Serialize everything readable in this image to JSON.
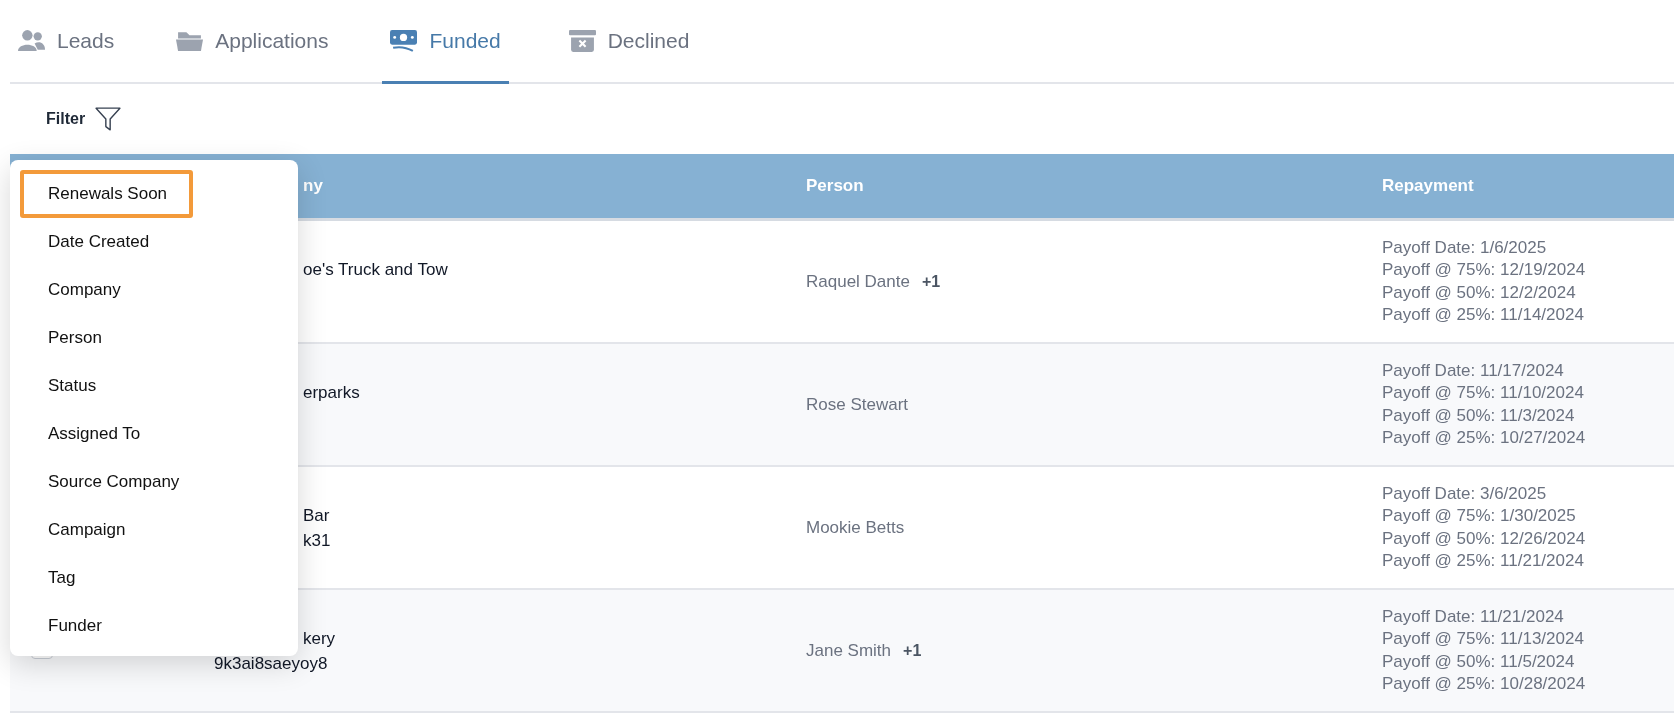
{
  "tabs": [
    {
      "label": "Leads",
      "selected": false
    },
    {
      "label": "Applications",
      "selected": false
    },
    {
      "label": "Funded",
      "selected": true
    },
    {
      "label": "Declined",
      "selected": false
    }
  ],
  "filter": {
    "label": "Filter"
  },
  "filter_menu": {
    "items": [
      {
        "label": "Renewals Soon",
        "selected": true
      },
      {
        "label": "Date Created",
        "selected": false
      },
      {
        "label": "Company",
        "selected": false
      },
      {
        "label": "Person",
        "selected": false
      },
      {
        "label": "Status",
        "selected": false
      },
      {
        "label": "Assigned To",
        "selected": false
      },
      {
        "label": "Source Company",
        "selected": false
      },
      {
        "label": "Campaign",
        "selected": false
      },
      {
        "label": "Tag",
        "selected": false
      },
      {
        "label": "Funder",
        "selected": false
      }
    ]
  },
  "table": {
    "columns": [
      "ny",
      "Person",
      "Repayment"
    ],
    "rows": [
      {
        "company": [
          "oe's Truck and Tow"
        ],
        "person": "Raquel Dante",
        "extra": "+1",
        "repayment": [
          "Payoff Date: 1/6/2025",
          "Payoff @ 75%: 12/19/2024",
          "Payoff @ 50%: 12/2/2024",
          "Payoff @ 25%: 11/14/2024"
        ]
      },
      {
        "company": [
          "erparks"
        ],
        "person": "Rose Stewart",
        "repayment": [
          "Payoff Date: 11/17/2024",
          "Payoff @ 75%: 11/10/2024",
          "Payoff @ 50%: 11/3/2024",
          "Payoff @ 25%: 10/27/2024"
        ]
      },
      {
        "company": [
          "Bar",
          "k31"
        ],
        "person": "Mookie Betts",
        "repayment": [
          "Payoff Date: 3/6/2025",
          "Payoff @ 75%: 1/30/2025",
          "Payoff @ 50%: 12/26/2024",
          "Payoff @ 25%: 11/21/2024"
        ]
      },
      {
        "checked": false,
        "company": [
          "kery",
          "9k3ai8saeyoy8"
        ],
        "person": "Jane Smith",
        "extra": "+1",
        "repayment": [
          "Payoff Date: 11/21/2024",
          "Payoff @ 75%: 11/13/2024",
          "Payoff @ 50%: 11/5/2024",
          "Payoff @ 25%: 10/28/2024"
        ]
      }
    ]
  }
}
